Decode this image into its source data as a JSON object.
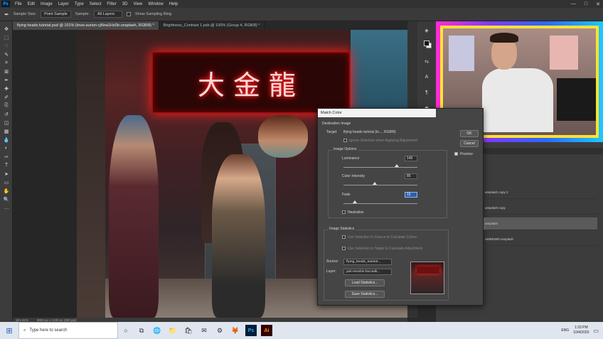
{
  "menubar": {
    "logo": "Ps",
    "items": [
      "File",
      "Edit",
      "Image",
      "Layer",
      "Type",
      "Select",
      "Filter",
      "3D",
      "View",
      "Window",
      "Help"
    ],
    "window_controls": [
      "—",
      "□",
      "✕"
    ]
  },
  "options_bar": {
    "sample_size_label": "Sample Size:",
    "sample_size_value": "Point Sample",
    "sample_label": "Sample:",
    "sample_value": "All Layers",
    "show_sampling_ring_label": "Show Sampling Ring"
  },
  "tabs": [
    {
      "label": "flying heads tutorial.psd @ 101% (levis-aurion-cjNna1Hz0b-unsplash, RGB/8) *",
      "active": true
    },
    {
      "label": "Brightness_Contrast 1.psb @ 100% (Group 4, RGB/8) *",
      "active": false
    }
  ],
  "toolbar": {
    "icons": [
      "move-icon",
      "artboard-icon",
      "lasso-icon",
      "quick-select-icon",
      "crop-icon",
      "frame-icon",
      "eyedropper-icon",
      "healing-icon",
      "brush-icon",
      "stamp-icon",
      "history-brush-icon",
      "eraser-icon",
      "gradient-icon",
      "blur-icon",
      "dodge-icon",
      "pen-icon",
      "type-icon",
      "path-select-icon",
      "shape-icon",
      "hand-icon",
      "zoom-icon",
      "more-icon"
    ],
    "glyphs": [
      "✥",
      "⬚",
      "◌",
      "✎",
      "⌗",
      "⊠",
      "✒",
      "✚",
      "✐",
      "⎘",
      "↺",
      "◫",
      "▦",
      "💧",
      "◐",
      "✑",
      "T",
      "➤",
      "▭",
      "✋",
      "🔍",
      "…"
    ]
  },
  "canvas": {
    "neon_text": "大金龍",
    "status_zoom": "101.51%",
    "status_doc": "3800 px x 1330 px (300 ppi)"
  },
  "swatches": {
    "fg": "#111111",
    "bg": "#f2f2f2"
  },
  "right_tools": [
    "◈",
    "✎",
    "⇆",
    "A",
    "¶",
    "⬢"
  ],
  "layers": {
    "rows": [
      {
        "label": "unsplash copy 2",
        "selected": false
      },
      {
        "label": "unsplash copy",
        "selected": false
      },
      {
        "label": "unsplash",
        "selected": true
      },
      {
        "label": "AMDKWR-unsplash",
        "selected": false
      }
    ]
  },
  "dialog": {
    "title": "Match Color",
    "destination_label": "Destination Image",
    "target_label": "Target:",
    "target_value": "flying heads tutorial (le..., RGB/8)",
    "ignore_selection": "Ignore Selection when Applying Adjustment",
    "image_options_label": "Image Options",
    "luminance_label": "Luminance",
    "luminance_value": "145",
    "luminance_pct": 0.72,
    "color_intensity_label": "Color Intensity",
    "color_intensity_value": "85",
    "color_intensity_pct": 0.42,
    "fade_label": "Fade",
    "fade_value": "15",
    "fade_pct": 0.15,
    "neutralize_label": "Neutralize",
    "image_statistics_label": "Image Statistics",
    "use_sel_source": "Use Selection in Source to Calculate Colors",
    "use_sel_target": "Use Selection in Target to Calculate Adjustment",
    "source_label": "Source:",
    "source_value": "flying_heads_tutorial...",
    "layer_label": "Layer:",
    "layer_value": "jaim-levshin-faccedit...",
    "load_stats": "Load Statistics...",
    "save_stats": "Save Statistics...",
    "ok": "OK",
    "cancel": "Cancel",
    "preview_label": "Preview"
  },
  "taskbar": {
    "search_placeholder": "Type here to search",
    "icons": [
      "○",
      "⧉",
      "🌐",
      "📁",
      "🛍",
      "✉",
      "⚙",
      "🦊",
      "Ps",
      "Ai"
    ],
    "icon_names": [
      "cortana-icon",
      "task-view-icon",
      "edge-icon",
      "file-explorer-icon",
      "store-icon",
      "mail-icon",
      "settings-icon",
      "browser-icon",
      "photoshop-icon",
      "illustrator-icon"
    ],
    "lang": "ENG",
    "time": "1:33 PM",
    "date": "10/4/2020"
  }
}
